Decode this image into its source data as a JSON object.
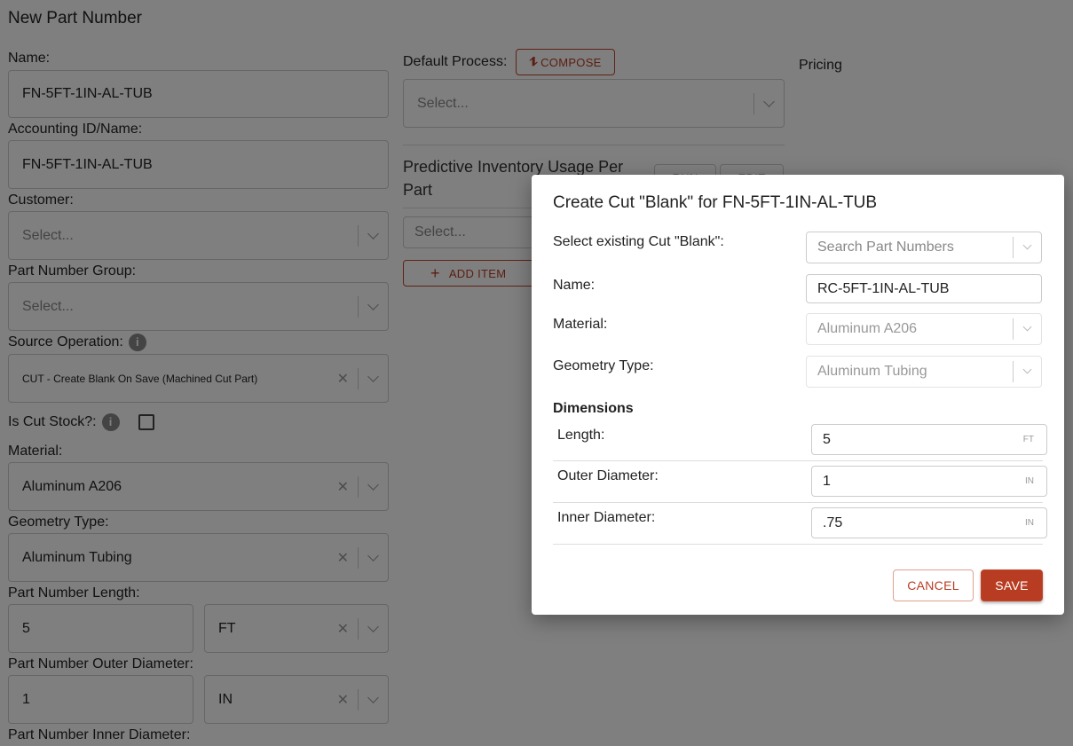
{
  "page": {
    "title": "New Part Number"
  },
  "form": {
    "name": {
      "label": "Name:",
      "value": "FN-5FT-1IN-AL-TUB"
    },
    "accounting": {
      "label": "Accounting ID/Name:",
      "value": "FN-5FT-1IN-AL-TUB"
    },
    "customer": {
      "label": "Customer:",
      "placeholder": "Select..."
    },
    "group": {
      "label": "Part Number Group:",
      "placeholder": "Select..."
    },
    "source_operation": {
      "label": "Source Operation:",
      "value": "CUT - Create Blank On Save (Machined Cut Part)"
    },
    "is_cut_stock": {
      "label": "Is Cut Stock?:",
      "checked": false
    },
    "material": {
      "label": "Material:",
      "value": "Aluminum A206"
    },
    "geometry": {
      "label": "Geometry Type:",
      "value": "Aluminum Tubing"
    },
    "length": {
      "label": "Part Number Length:",
      "value": "5",
      "unit": "FT"
    },
    "outer": {
      "label": "Part Number Outer Diameter:",
      "value": "1",
      "unit": "IN"
    },
    "inner": {
      "label": "Part Number Inner Diameter:"
    }
  },
  "process": {
    "label": "Default Process:",
    "compose": "COMPOSE",
    "placeholder": "Select..."
  },
  "predictive": {
    "title": "Predictive Inventory Usage Per Part",
    "run": "RUN",
    "edit": "EDIT",
    "placeholder": "Select...",
    "add_item": "ADD ITEM"
  },
  "pricing": {
    "label": "Pricing"
  },
  "modal": {
    "title": "Create Cut \"Blank\" for FN-5FT-1IN-AL-TUB",
    "existing": {
      "label": "Select existing Cut \"Blank\":",
      "placeholder": "Search Part Numbers"
    },
    "name": {
      "label": "Name:",
      "value": "RC-5FT-1IN-AL-TUB"
    },
    "material": {
      "label": "Material:",
      "value": "Aluminum A206"
    },
    "geometry": {
      "label": "Geometry Type:",
      "value": "Aluminum Tubing"
    },
    "dimensions": {
      "title": "Dimensions",
      "length": {
        "label": "Length:",
        "value": "5",
        "unit": "FT"
      },
      "outer": {
        "label": "Outer Diameter:",
        "value": "1",
        "unit": "IN"
      },
      "inner": {
        "label": "Inner Diameter:",
        "value": ".75",
        "unit": "IN"
      }
    },
    "cancel": "CANCEL",
    "save": "SAVE"
  },
  "colors": {
    "accent": "#b83c22",
    "overlay": "rgba(0,0,0,0.5)"
  }
}
